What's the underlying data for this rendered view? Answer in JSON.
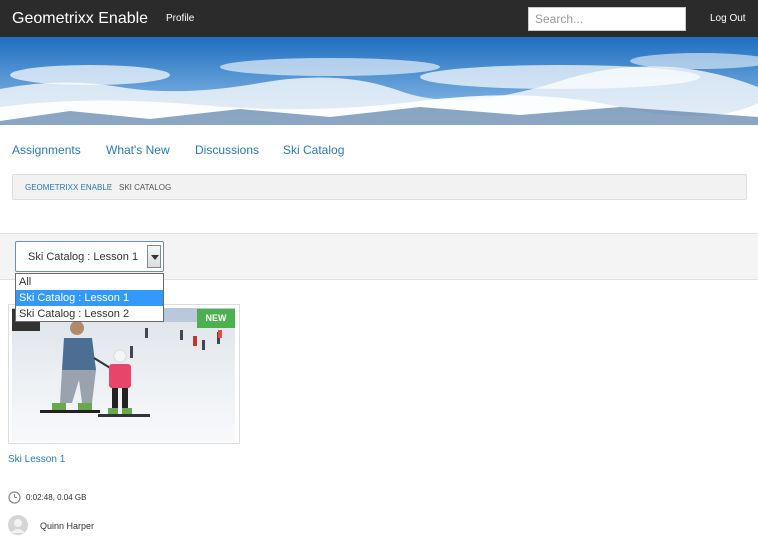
{
  "topbar": {
    "brand": "Geometrixx Enable",
    "profile_label": "Profile",
    "search_placeholder": "Search...",
    "logout_label": "Log Out"
  },
  "nav": {
    "items": [
      "Assignments",
      "What's New",
      "Discussions",
      "Ski Catalog"
    ]
  },
  "breadcrumb": {
    "home": "GEOMETRIXX ENABLE",
    "separator": "/",
    "current": "SKI CATALOG"
  },
  "filter": {
    "selected": "Ski Catalog : Lesson 1",
    "options": [
      "All",
      "Ski Catalog : Lesson 1",
      "Ski Catalog : Lesson 2"
    ]
  },
  "card": {
    "badge": "NEW",
    "title": "Ski Lesson 1",
    "meta": "0:02:48,  0.04 GB",
    "author": "Quinn Harper"
  },
  "colors": {
    "topbar": "#2b2b2b",
    "link": "#2a7ab0",
    "badge": "#4caf50",
    "selected_option": "#3399ff"
  }
}
